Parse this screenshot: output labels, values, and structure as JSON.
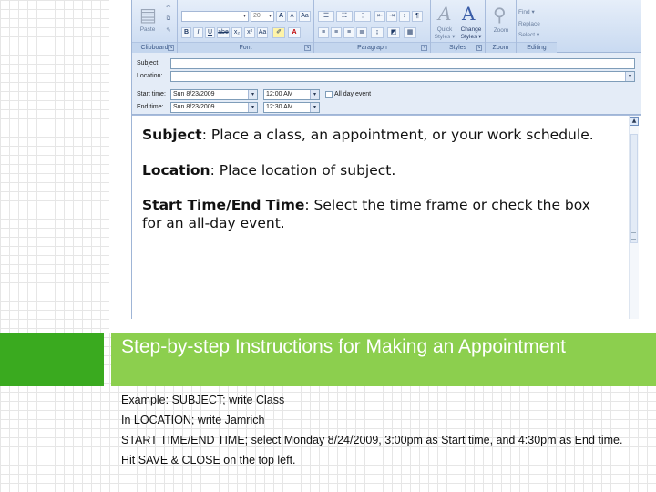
{
  "ribbon": {
    "paste_label": "Paste",
    "font_name": "",
    "font_size": "20",
    "bold": "B",
    "italic": "I",
    "underline": "U",
    "strike": "abe",
    "subscript": "x₂",
    "superscript": "x²",
    "grow_font": "A",
    "shrink_font": "A",
    "change_case": "Aa",
    "quick_styles": "Quick\nStyles ▾",
    "change_styles": "Change\nStyles ▾",
    "zoom_label": "Zoom",
    "find_label": "Find ▾",
    "replace_label": "Replace",
    "select_label": "Select ▾",
    "groups": {
      "clipboard": "Clipboard",
      "font": "Font",
      "paragraph": "Paragraph",
      "styles": "Styles",
      "zoom": "Zoom",
      "editing": "Editing"
    }
  },
  "form": {
    "subject_label": "Subject:",
    "subject_value": "",
    "location_label": "Location:",
    "location_value": "",
    "start_label": "Start time:",
    "start_date": "Sun 8/23/2009",
    "start_time": "12:00 AM",
    "all_day_label": "All day event",
    "end_label": "End time:",
    "end_date": "Sun 8/23/2009",
    "end_time": "12:30 AM"
  },
  "editor": {
    "p1_bold": "Subject",
    "p1_text": ": Place a class, an appointment, or your work schedule.",
    "p2_bold": "Location",
    "p2_text": ": Place location of subject.",
    "p3_bold": "Start Time/End Time",
    "p3_text": ": Select the time frame or check the box for an all-day event."
  },
  "caption": {
    "title": "Step-by-step Instructions for Making an Appointment",
    "notes": [
      "Example: SUBJECT; write Class",
      "In LOCATION; write Jamrich",
      "START TIME/END TIME; select Monday 8/24/2009, 3:00pm as Start time, and 4:30pm as End time.",
      "Hit SAVE & CLOSE on the top left."
    ]
  },
  "colors": {
    "banner": "#8ccf4e",
    "green_block": "#3aaa1f",
    "ribbon": "#c9daf1"
  }
}
